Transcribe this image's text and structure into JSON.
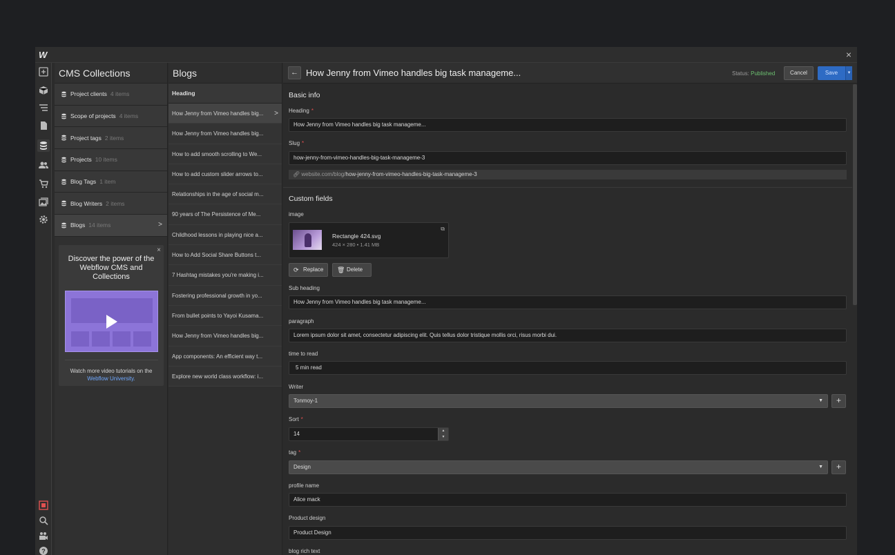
{
  "topbar": {
    "logo": "W",
    "close": "×"
  },
  "rail": {
    "icons": [
      "add-icon",
      "box-icon",
      "navigator-icon",
      "pages-icon",
      "cms-icon",
      "users-icon",
      "ecommerce-icon",
      "assets-icon",
      "settings-icon",
      "audit-icon",
      "search-icon",
      "video-icon",
      "help-icon"
    ]
  },
  "collections": {
    "title": "CMS Collections",
    "items": [
      {
        "name": "Project clients",
        "count": "4 items"
      },
      {
        "name": "Scope of projects",
        "count": "4 items"
      },
      {
        "name": "Project tags",
        "count": "2 items"
      },
      {
        "name": "Projects",
        "count": "10 items"
      },
      {
        "name": "Blog Tags",
        "count": "1 item"
      },
      {
        "name": "Blog Writers",
        "count": "2 items"
      },
      {
        "name": "Blogs",
        "count": "14 items"
      }
    ],
    "promo": {
      "title": "Discover the power of the Webflow CMS and Collections",
      "footer": "Watch more video tutorials on the",
      "link": "Webflow University."
    }
  },
  "blogs": {
    "title": "Blogs",
    "column_header": "Heading",
    "items": [
      "How Jenny from Vimeo handles big...",
      "How Jenny from Vimeo handles big...",
      "How to add smooth scrolling to We...",
      "How to add custom slider arrows to...",
      "Relationships in the age of social m...",
      "90 years of The Persistence of Me...",
      "Childhood lessons in playing nice a...",
      "How to Add Social Share Buttons t...",
      "7 Hashtag mistakes you're making i...",
      "Fostering professional growth in yo...",
      "From bullet points to Yayoi Kusama...",
      "How Jenny from Vimeo handles big...",
      "App components: An efficient way t...",
      "Explore new world class workflow: i..."
    ]
  },
  "editor": {
    "back": "←",
    "title": "How Jenny from Vimeo handles big task manageme...",
    "status_label": "Status:",
    "status_value": "Published",
    "cancel": "Cancel",
    "save": "Save",
    "save_caret": "▾",
    "basic_info": "Basic info",
    "heading_label": "Heading",
    "heading_value": "How Jenny from Vimeo handles big task manageme...",
    "slug_label": "Slug",
    "slug_value": "how-jenny-from-vimeo-handles-big-task-manageme-3",
    "slug_url_prefix": "website.com/blog/",
    "slug_url_slug": "how-jenny-from-vimeo-handles-big-task-manageme-3",
    "custom_fields": "Custom fields",
    "image_label": "image",
    "image_name": "Rectangle 424.svg",
    "image_meta": "424 × 280 • 1.41 MB",
    "replace": "Replace",
    "delete": "Delete",
    "subheading_label": "Sub heading",
    "subheading_value": "How Jenny from Vimeo handles big task manageme...",
    "paragraph_label": "paragraph",
    "paragraph_value": "Lorem ipsum dolor sit amet, consectetur adipiscing elit. Quis tellus dolor tristique mollis orci, risus morbi dui.",
    "time_label": "time to read",
    "time_value": "5 min read",
    "writer_label": "Writer",
    "writer_value": "Tonmoy-1",
    "sort_label": "Sort",
    "sort_value": "14",
    "tag_label": "tag",
    "tag_value": "Design",
    "profile_label": "profile name",
    "profile_value": "Alice mack",
    "product_label": "Product design",
    "product_value": "Product Design",
    "rich_label": "blog rich text",
    "required_mark": "*"
  }
}
